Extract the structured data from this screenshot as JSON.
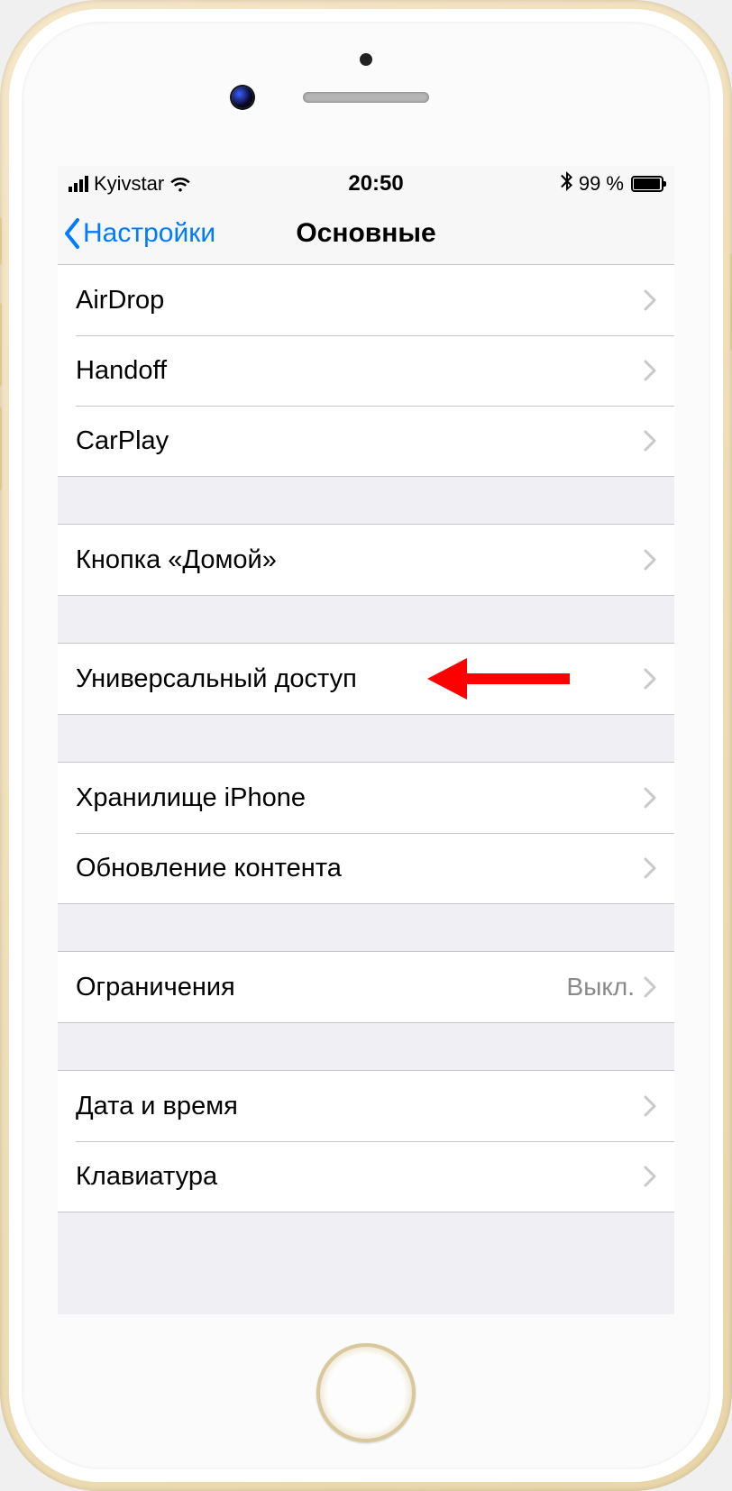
{
  "statusbar": {
    "carrier": "Kyivstar",
    "time": "20:50",
    "battery_pct": "99 %"
  },
  "navbar": {
    "back_label": "Настройки",
    "title": "Основные"
  },
  "groups": [
    {
      "rows": [
        {
          "label": "AirDrop"
        },
        {
          "label": "Handoff"
        },
        {
          "label": "CarPlay"
        }
      ]
    },
    {
      "rows": [
        {
          "label": "Кнопка «Домой»"
        }
      ]
    },
    {
      "rows": [
        {
          "label": "Универсальный доступ"
        }
      ]
    },
    {
      "rows": [
        {
          "label": "Хранилище iPhone"
        },
        {
          "label": "Обновление контента"
        }
      ]
    },
    {
      "rows": [
        {
          "label": "Ограничения",
          "value": "Выкл."
        }
      ]
    },
    {
      "rows": [
        {
          "label": "Дата и время"
        },
        {
          "label": "Клавиатура"
        }
      ]
    }
  ]
}
